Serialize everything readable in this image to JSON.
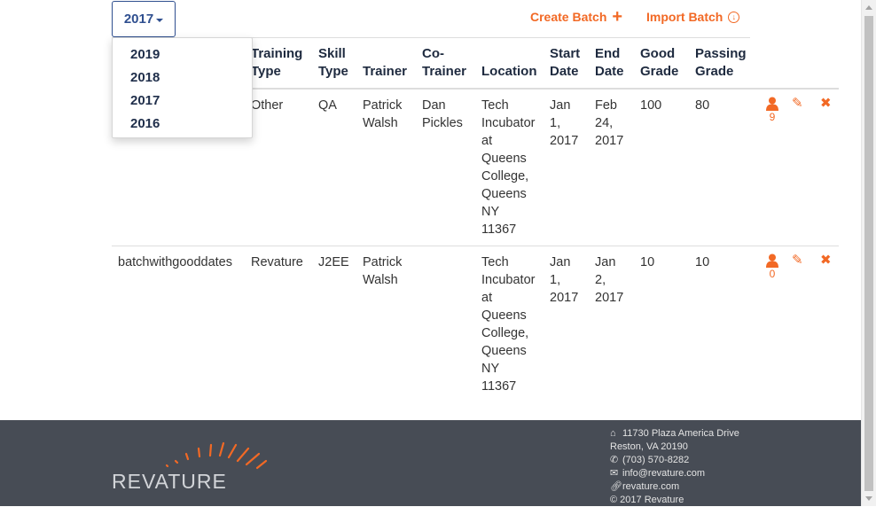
{
  "year_selector": {
    "selected": "2017",
    "options": [
      "2019",
      "2018",
      "2017",
      "2016"
    ]
  },
  "actions": {
    "create_label": "Create Batch",
    "create_icon": "plus-icon",
    "import_label": "Import Batch",
    "import_icon": "circle-arrow-down-icon"
  },
  "table": {
    "headers": {
      "training_type": [
        "Training",
        "Type"
      ],
      "skill_type": [
        "Skill",
        "Type"
      ],
      "trainer": [
        "Trainer"
      ],
      "co_trainer": [
        "Co-",
        "Trainer"
      ],
      "location": [
        "Location"
      ],
      "start_date": [
        "Start",
        "Date"
      ],
      "end_date": [
        "End",
        "Date"
      ],
      "good_grade": [
        "Good",
        "Grade"
      ],
      "passing_grade": [
        "Passing",
        "Grade"
      ]
    },
    "rows": [
      {
        "name": "",
        "training_type": "Other",
        "skill_type": "QA",
        "trainer": [
          "Patrick",
          "Walsh"
        ],
        "co_trainer": [
          "Dan",
          "Pickles"
        ],
        "location": [
          "Tech",
          "Incubator",
          "at",
          "Queens",
          "College,",
          "Queens",
          "NY",
          "11367"
        ],
        "start_date": [
          "Jan",
          "1,",
          "2017"
        ],
        "end_date": [
          "Feb",
          "24,",
          "2017"
        ],
        "good_grade": "100",
        "passing_grade": "80",
        "trainee_count": "9"
      },
      {
        "name": "batchwithgooddates",
        "training_type": "Revature",
        "skill_type": "J2EE",
        "trainer": [
          "Patrick",
          "Walsh"
        ],
        "co_trainer": [],
        "location": [
          "Tech",
          "Incubator",
          "at",
          "Queens",
          "College,",
          "Queens",
          "NY",
          "11367"
        ],
        "start_date": [
          "Jan",
          "1,",
          "2017"
        ],
        "end_date": [
          "Jan",
          "2,",
          "2017"
        ],
        "good_grade": "10",
        "passing_grade": "10",
        "trainee_count": "0"
      }
    ]
  },
  "footer": {
    "logo_text": "REVATURE",
    "address_line1": "11730 Plaza America Drive",
    "address_line2": "Reston, VA 20190",
    "phone": "(703) 570-8282",
    "email": "info@revature.com",
    "website": "revature.com",
    "copyright": "© 2017 Revature"
  },
  "colors": {
    "accent": "#f26925",
    "primary": "#2f4f8f",
    "footer_bg": "#474c55"
  }
}
